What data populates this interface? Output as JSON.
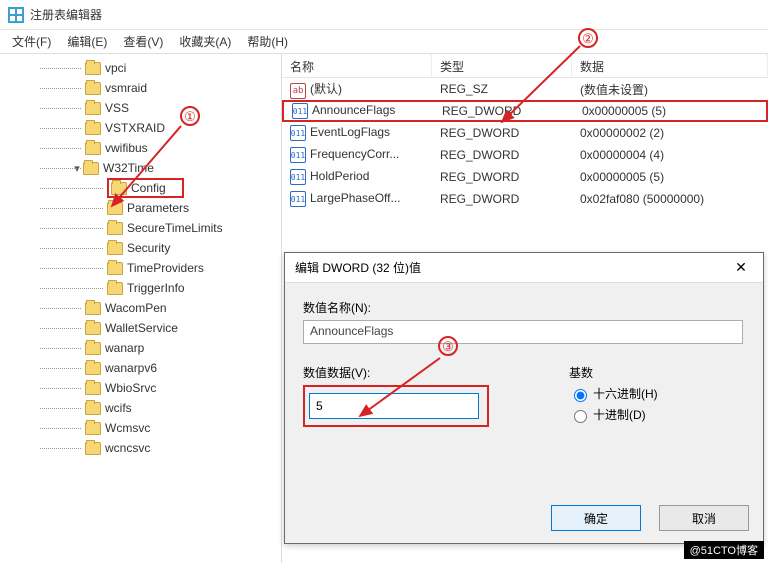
{
  "window": {
    "title": "注册表编辑器"
  },
  "menu": {
    "file": "文件(F)",
    "edit": "编辑(E)",
    "view": "查看(V)",
    "favorites": "收藏夹(A)",
    "help": "帮助(H)"
  },
  "tree": {
    "items": [
      {
        "label": "vpci",
        "indent": 85
      },
      {
        "label": "vsmraid",
        "indent": 85
      },
      {
        "label": "VSS",
        "indent": 85
      },
      {
        "label": "VSTXRAID",
        "indent": 85
      },
      {
        "label": "vwifibus",
        "indent": 85
      },
      {
        "label": "W32Time",
        "indent": 85,
        "expanded": true
      },
      {
        "label": "Config",
        "indent": 107,
        "boxed": true
      },
      {
        "label": "Parameters",
        "indent": 107
      },
      {
        "label": "SecureTimeLimits",
        "indent": 107
      },
      {
        "label": "Security",
        "indent": 107
      },
      {
        "label": "TimeProviders",
        "indent": 107
      },
      {
        "label": "TriggerInfo",
        "indent": 107
      },
      {
        "label": "WacomPen",
        "indent": 85
      },
      {
        "label": "WalletService",
        "indent": 85
      },
      {
        "label": "wanarp",
        "indent": 85
      },
      {
        "label": "wanarpv6",
        "indent": 85
      },
      {
        "label": "WbioSrvc",
        "indent": 85
      },
      {
        "label": "wcifs",
        "indent": 85
      },
      {
        "label": "Wcmsvc",
        "indent": 85
      },
      {
        "label": "wcncsvc",
        "indent": 85
      }
    ]
  },
  "list": {
    "header": {
      "name": "名称",
      "type": "类型",
      "data": "数据"
    },
    "rows": [
      {
        "icon": "ab",
        "name": "(默认)",
        "type": "REG_SZ",
        "data": "(数值未设置)"
      },
      {
        "icon": "bin",
        "name": "AnnounceFlags",
        "type": "REG_DWORD",
        "data": "0x00000005 (5)",
        "boxed": true
      },
      {
        "icon": "bin",
        "name": "EventLogFlags",
        "type": "REG_DWORD",
        "data": "0x00000002 (2)"
      },
      {
        "icon": "bin",
        "name": "FrequencyCorr...",
        "type": "REG_DWORD",
        "data": "0x00000004 (4)"
      },
      {
        "icon": "bin",
        "name": "HoldPeriod",
        "type": "REG_DWORD",
        "data": "0x00000005 (5)"
      },
      {
        "icon": "bin",
        "name": "LargePhaseOff...",
        "type": "REG_DWORD",
        "data": "0x02faf080 (50000000)"
      }
    ]
  },
  "dialog": {
    "title": "编辑 DWORD (32 位)值",
    "name_label": "数值名称(N):",
    "name_value": "AnnounceFlags",
    "data_label": "数值数据(V):",
    "data_value": "5",
    "base_label": "基数",
    "hex_label": "十六进制(H)",
    "dec_label": "十进制(D)",
    "ok": "确定",
    "cancel": "取消"
  },
  "annotations": {
    "a1": "①",
    "a2": "②",
    "a3": "③"
  },
  "watermark": "@51CTO博客"
}
